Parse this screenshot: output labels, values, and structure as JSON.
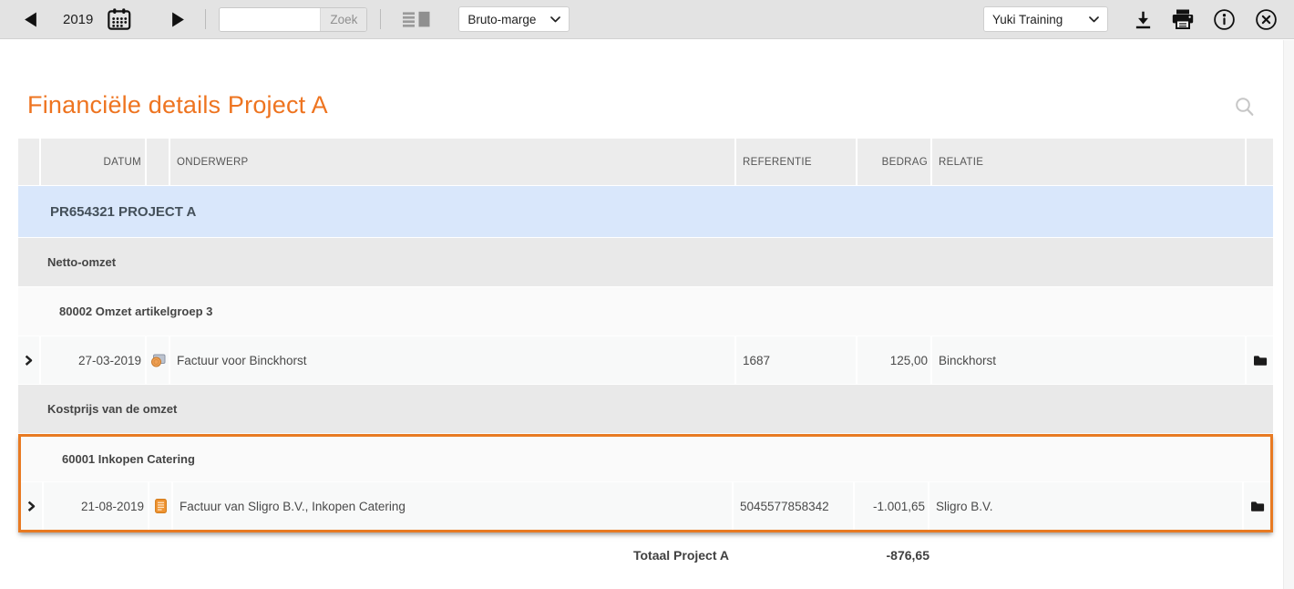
{
  "toolbar": {
    "year": "2019",
    "search_placeholder": "",
    "search_button_label": "Zoek",
    "view_select_value": "Bruto-marge",
    "account_select_value": "Yuki Training"
  },
  "page": {
    "title": "Financiële details Project A"
  },
  "table": {
    "headers": {
      "date": "DATUM",
      "subject": "ONDERWERP",
      "reference": "REFERENTIE",
      "amount": "BEDRAG",
      "relation": "RELATIE"
    },
    "project": {
      "title": "PR654321 PROJECT A",
      "groups": [
        {
          "name": "Netto-omzet",
          "accounts": [
            {
              "name": "80002 Omzet artikelgroep 3",
              "entries": [
                {
                  "date": "27-03-2019",
                  "subject": "Factuur voor Binckhorst",
                  "reference": "1687",
                  "amount": "125,00",
                  "relation": "Binckhorst"
                }
              ]
            }
          ]
        },
        {
          "name": "Kostprijs van de omzet",
          "accounts": [
            {
              "name": "60001 Inkopen Catering",
              "highlighted": true,
              "entries": [
                {
                  "date": "21-08-2019",
                  "subject": "Factuur van Sligro B.V., Inkopen Catering",
                  "reference": "5045577858342",
                  "amount": "-1.001,65",
                  "relation": "Sligro B.V."
                }
              ]
            }
          ]
        }
      ],
      "total": {
        "label": "Totaal Project A",
        "amount": "-876,65"
      }
    }
  },
  "icons": {
    "prev-year": "left-triangle",
    "calendar": "calendar-grid",
    "next-year": "right-triangle",
    "layout-toggle": "list-with-block",
    "download": "arrow-down-to-bar",
    "print": "printer",
    "info": "circled-i",
    "close": "circled-x",
    "search": "magnifier",
    "sales-invoice": "coins",
    "purchase-invoice": "orange-document",
    "archive": "black-folder",
    "expand": "chevron-right"
  },
  "colors": {
    "accent_orange": "#ee7420",
    "highlight_border": "#e87a22",
    "project_row_blue": "#d9e7fb",
    "group_row_gray": "#e9e9e9",
    "toolbar_gray": "#e3e3e3"
  }
}
